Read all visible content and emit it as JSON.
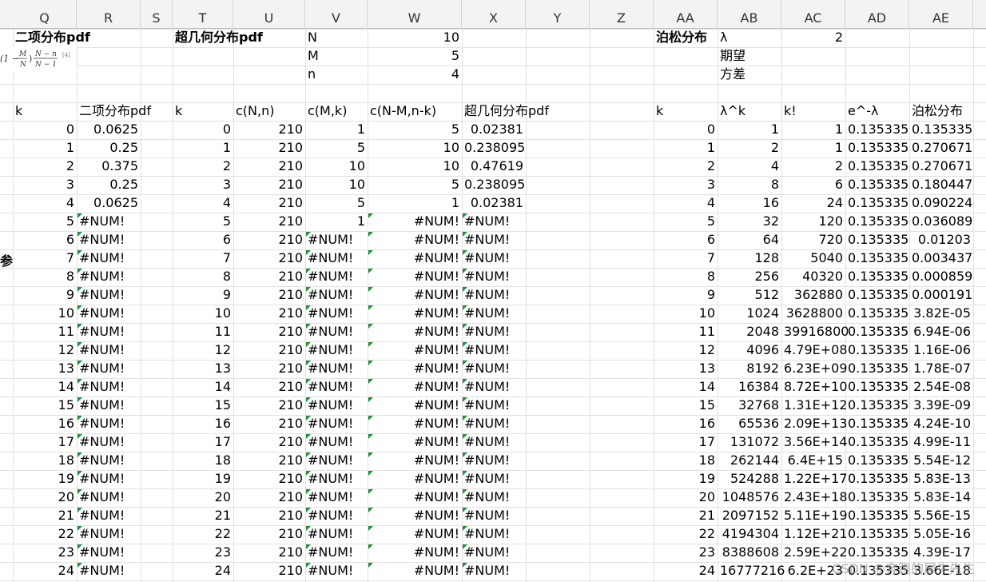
{
  "columns": [
    "Q",
    "R",
    "S",
    "T",
    "U",
    "V",
    "W",
    "X",
    "Y",
    "Z",
    "AA",
    "AB",
    "AC",
    "AD",
    "AE"
  ],
  "binomial": {
    "title": "二项分布pdf",
    "header_k": "k",
    "header_pdf": "二项分布pdf",
    "values": [
      "0.0625",
      "0.25",
      "0.375",
      "0.25",
      "0.0625"
    ]
  },
  "formula_text": "(1 − M/N)(N − n)/(N − 1) [4]",
  "hyper": {
    "title": "超几何分布pdf",
    "params": [
      {
        "label": "N",
        "value": "10"
      },
      {
        "label": "M",
        "value": "5"
      },
      {
        "label": "n",
        "value": "4"
      }
    ],
    "headers": [
      "k",
      "c(N,n)",
      "c(M,k)",
      "c(N-M,n-k)",
      "超几何分布pdf"
    ],
    "cNn": "210",
    "cMk": [
      "1",
      "5",
      "10",
      "10",
      "5",
      "1"
    ],
    "cNMnk": [
      "5",
      "10",
      "10",
      "5",
      "1"
    ],
    "pdf": [
      "0.02381",
      "0.238095",
      "0.47619",
      "0.238095",
      "0.02381"
    ]
  },
  "error": "#NUM!",
  "left_fragment": "参",
  "poisson": {
    "title": "泊松分布",
    "lambda_label": "λ",
    "lambda_value": "2",
    "expect_label": "期望",
    "variance_label": "方差",
    "headers": [
      "k",
      "λ^k",
      "k!",
      "e^-λ",
      "泊松分布"
    ],
    "lk": [
      "1",
      "2",
      "4",
      "8",
      "16",
      "32",
      "64",
      "128",
      "256",
      "512",
      "1024",
      "2048",
      "4096",
      "8192",
      "16384",
      "32768",
      "65536",
      "131072",
      "262144",
      "524288",
      "1048576",
      "2097152",
      "4194304",
      "8388608",
      "16777216"
    ],
    "kf": [
      "1",
      "1",
      "2",
      "6",
      "24",
      "120",
      "720",
      "5040",
      "40320",
      "362880",
      "3628800",
      "39916800",
      "4.79E+08",
      "6.23E+09",
      "8.72E+10",
      "1.31E+12",
      "2.09E+13",
      "3.56E+14",
      "6.4E+15",
      "1.22E+17",
      "2.43E+18",
      "5.11E+19",
      "1.12E+21",
      "2.59E+22",
      "6.2E+23"
    ],
    "el": "0.135335",
    "dist": [
      "0.135335",
      "0.270671",
      "0.270671",
      "0.180447",
      "0.090224",
      "0.036089",
      "0.01203",
      "0.003437",
      "0.000859",
      "0.000191",
      "3.82E-05",
      "6.94E-06",
      "1.16E-06",
      "1.78E-07",
      "2.54E-08",
      "3.39E-09",
      "4.24E-10",
      "4.99E-11",
      "5.54E-12",
      "5.83E-13",
      "5.83E-14",
      "5.56E-15",
      "5.05E-16",
      "4.39E-17",
      "3.66E-18"
    ]
  },
  "k_values": [
    "0",
    "1",
    "2",
    "3",
    "4",
    "5",
    "6",
    "7",
    "8",
    "9",
    "10",
    "11",
    "12",
    "13",
    "14",
    "15",
    "16",
    "17",
    "18",
    "19",
    "20",
    "21",
    "22",
    "23",
    "24"
  ],
  "watermark": "CSDN @奔跑的犀牛先生"
}
